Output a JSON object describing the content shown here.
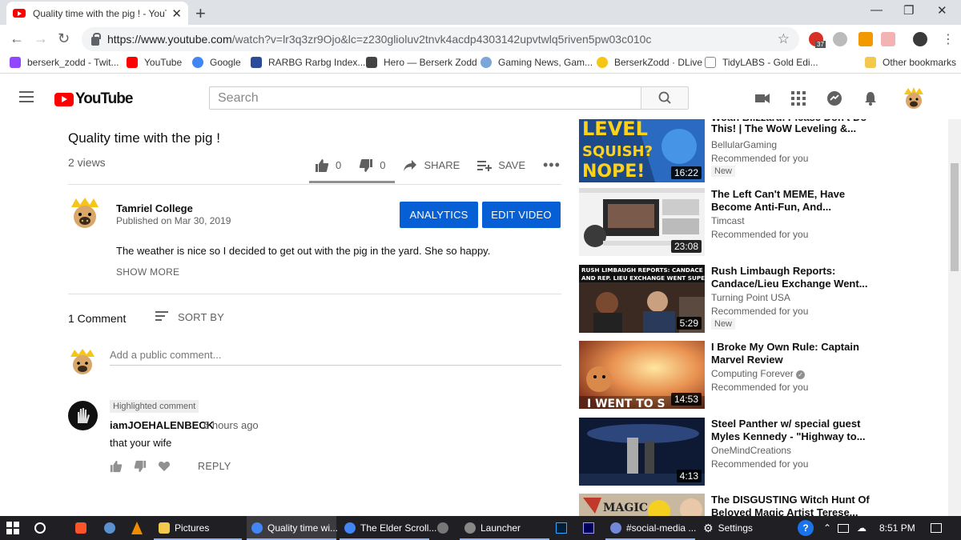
{
  "browser": {
    "tab_title": "Quality time with the pig ! - YouT",
    "url_host": "https://www.youtube.com",
    "url_path": "/watch?v=lr3q3zr9Ojo&lc=z230glioluv2tnvk4acdp4303142upvtwlq5riven5pw03c010c",
    "bookmarks": [
      {
        "label": "berserk_zodd - Twit...",
        "color": "#9146ff"
      },
      {
        "label": "YouTube",
        "color": "#ff0000"
      },
      {
        "label": "Google",
        "color": "#4285f4"
      },
      {
        "label": "RARBG Rarbg Index...",
        "color": "#2a4a9a"
      },
      {
        "label": "Hero — Berserk Zodd",
        "color": "#444444"
      },
      {
        "label": "Gaming News, Gam...",
        "color": "#7aa6d8"
      },
      {
        "label": "BerserkZodd · DLive",
        "color": "#f5c518"
      },
      {
        "label": "TidyLABS - Gold Edi...",
        "color": "#cccccc"
      }
    ],
    "other_bookmarks": "Other bookmarks",
    "ext_badge": "37"
  },
  "yt": {
    "search_placeholder": "Search",
    "logo_text": "YouTube",
    "video_title": "Quality time with the pig !",
    "views": "2 views",
    "likes": "0",
    "dislikes": "0",
    "share_label": "SHARE",
    "save_label": "SAVE",
    "channel_name": "Tamriel College",
    "published": "Published on Mar 30, 2019",
    "analytics_label": "ANALYTICS",
    "edit_label": "EDIT VIDEO",
    "description": "The weather is nice so I decided to get out with the pig in the yard. She so happy.",
    "show_more": "SHOW MORE",
    "comment_count": "1 Comment",
    "sort_by": "SORT BY",
    "add_comment_placeholder": "Add a public comment...",
    "comment": {
      "badge": "Highlighted comment",
      "author": "iamJOEHALENBECK",
      "time": "6 hours ago",
      "text": "that your wife",
      "reply": "REPLY"
    }
  },
  "sidebar": [
    {
      "title": "This! | The WoW Leveling &...",
      "title_top": "Woah Blizzard, Please Don't Do",
      "channel": "BellularGaming",
      "rec": "Recommended for you",
      "badge": "New",
      "duration": "16:22",
      "thumb_color": "#1c4a8a"
    },
    {
      "title": "The Left Can't MEME, Have Become Anti-Fun, And...",
      "channel": "Timcast",
      "rec": "Recommended for you",
      "badge": "",
      "duration": "23:08",
      "thumb_color": "#e8e8e8"
    },
    {
      "title": "Rush Limbaugh Reports: Candace/Lieu Exchange Went...",
      "channel": "Turning Point USA",
      "rec": "Recommended for you",
      "badge": "New",
      "duration": "5:29",
      "thumb_color": "#5a3a2a"
    },
    {
      "title": "I Broke My Own Rule: Captain Marvel Review",
      "channel": "Computing Forever",
      "rec": "Recommended for you",
      "badge": "",
      "duration": "14:53",
      "thumb_color": "#c87a3a"
    },
    {
      "title": "Steel Panther w/ special guest Myles Kennedy - \"Highway to...",
      "channel": "OneMindCreations",
      "rec": "Recommended for you",
      "badge": "",
      "duration": "4:13",
      "thumb_color": "#1a2a4a"
    },
    {
      "title": "The DISGUSTING Witch Hunt Of Beloved Magic Artist Terese...",
      "channel": "",
      "rec": "",
      "badge": "",
      "duration": "",
      "thumb_color": "#b8a890"
    }
  ],
  "taskbar": {
    "items": [
      {
        "label": "Pictures",
        "color": "#f2c94c"
      },
      {
        "label": "Quality time wi...",
        "color": "#4285f4"
      },
      {
        "label": "The Elder Scroll...",
        "color": "#4285f4"
      },
      {
        "label": "Launcher",
        "color": "#888888"
      },
      {
        "label": "#social-media ...",
        "color": "#7289da"
      },
      {
        "label": "Settings",
        "color": "#cccccc"
      }
    ],
    "time": "8:51 PM"
  },
  "colors": {
    "accent": "#065fd4",
    "yt_red": "#ff0000"
  }
}
